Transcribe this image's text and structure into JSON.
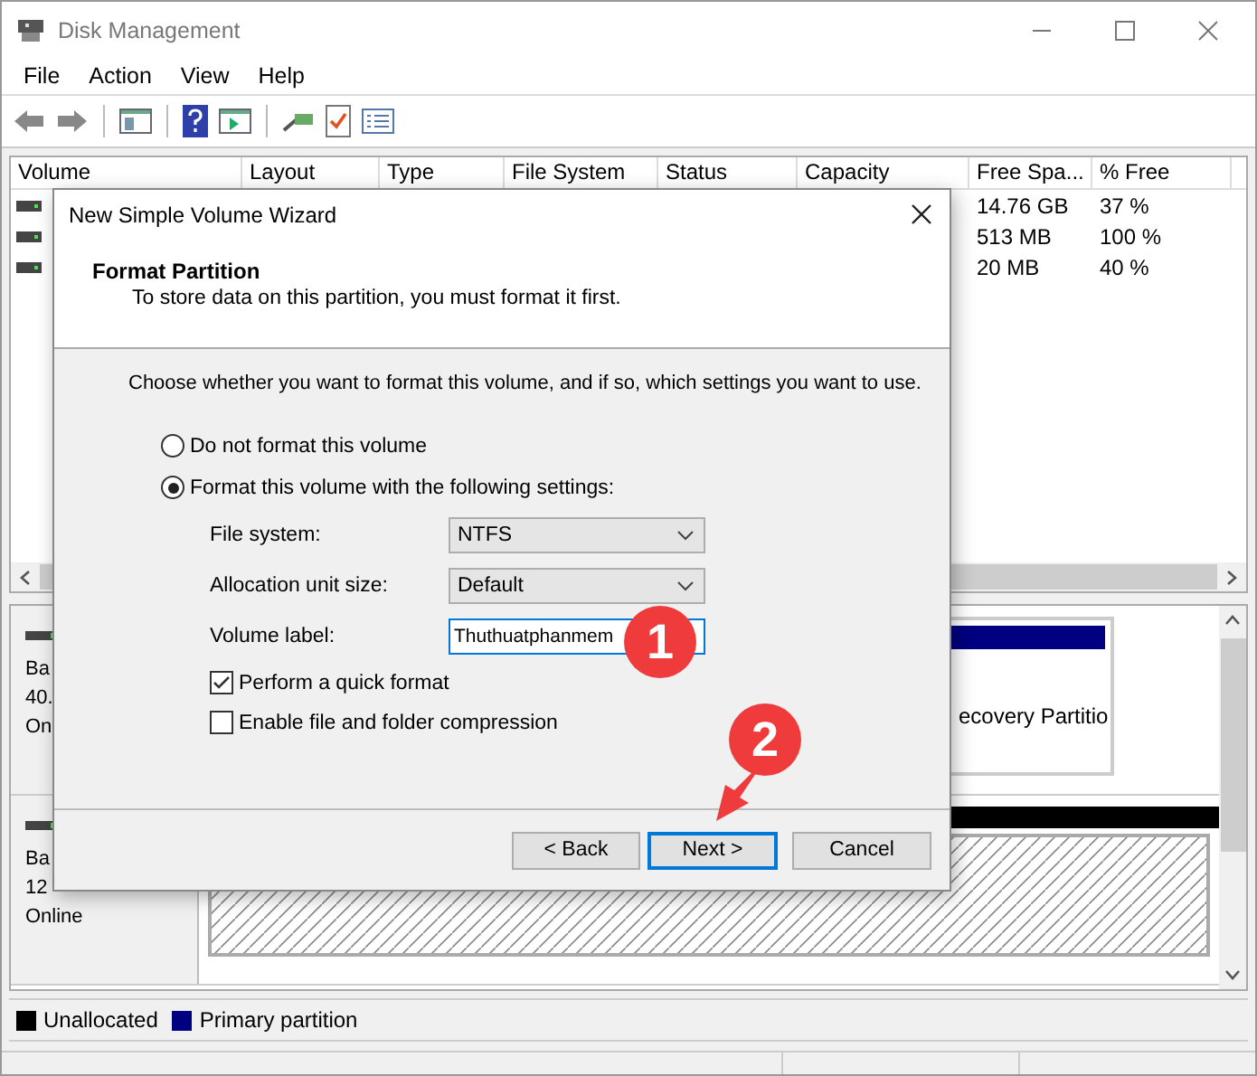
{
  "window": {
    "title": "Disk Management"
  },
  "menu": [
    "File",
    "Action",
    "View",
    "Help"
  ],
  "volume_table": {
    "columns": [
      "Volume",
      "Layout",
      "Type",
      "File System",
      "Status",
      "Capacity",
      "Free Spa...",
      "% Free"
    ],
    "rows": [
      {
        "free_space": "14.76 GB",
        "percent_free": "37 %"
      },
      {
        "free_space": "513 MB",
        "percent_free": "100 %"
      },
      {
        "free_space": "20 MB",
        "percent_free": "40 %"
      }
    ]
  },
  "disks": [
    {
      "lines": [
        "Ba",
        "40.",
        "On"
      ],
      "partition": {
        "kind": "primary",
        "label": "ecovery Partitio"
      }
    },
    {
      "lines": [
        "Ba",
        "12",
        "Online"
      ],
      "partition": {
        "kind": "unallocated"
      }
    }
  ],
  "legend": [
    {
      "label": "Unallocated",
      "color": "#000000"
    },
    {
      "label": "Primary partition",
      "color": "#000080"
    }
  ],
  "dialog": {
    "title": "New Simple Volume Wizard",
    "heading": "Format Partition",
    "subtitle": "To store data on this partition, you must format it first.",
    "instruction": "Choose whether you want to format this volume, and if so, which settings you want to use.",
    "options": [
      {
        "label": "Do not format this volume",
        "selected": false
      },
      {
        "label": "Format this volume with the following settings:",
        "selected": true
      }
    ],
    "fields": [
      {
        "label": "File system:",
        "kind": "select",
        "value": "NTFS"
      },
      {
        "label": "Allocation unit size:",
        "kind": "select",
        "value": "Default"
      },
      {
        "label": "Volume label:",
        "kind": "text",
        "value": "Thuthuatphanmem"
      }
    ],
    "checkboxes": [
      {
        "label": "Perform a quick format",
        "checked": true
      },
      {
        "label": "Enable file and folder compression",
        "checked": false
      }
    ],
    "buttons": [
      {
        "label": "< Back",
        "default": false
      },
      {
        "label": "Next >",
        "default": true
      },
      {
        "label": "Cancel",
        "default": false
      }
    ]
  },
  "annotations": [
    {
      "label": "1"
    },
    {
      "label": "2"
    }
  ]
}
